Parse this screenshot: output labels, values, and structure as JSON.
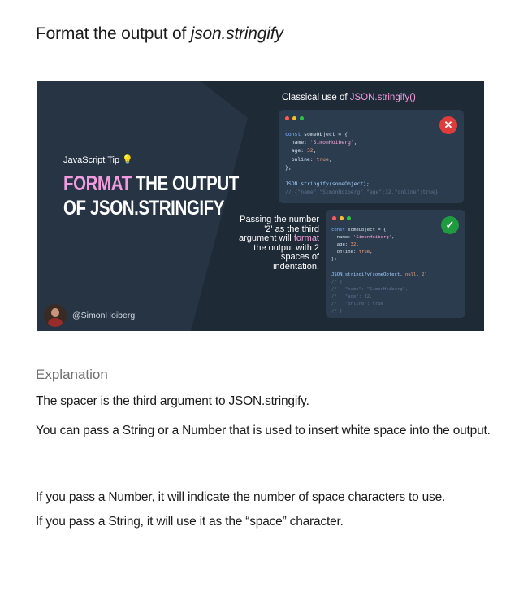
{
  "page": {
    "title_plain": "Format the output of ",
    "title_italic": "json.stringify"
  },
  "card": {
    "tip_label": "JavaScript Tip",
    "tip_icon": "lightbulb-icon",
    "headline_pink": "FORMAT",
    "headline_rest_line1": " THE OUTPUT",
    "headline_line2": "OF JSON.STRINGIFY",
    "author_handle": "@SimonHoiberg",
    "classic_title_plain": "Classical use of ",
    "classic_title_pink": "JSON.stringify()",
    "classic_code": {
      "line1_kw": "const",
      "line1_rest": " someObject = {",
      "line2_key": "  name: ",
      "line2_val": "'SimonHoiberg'",
      "line2_end": ",",
      "line3_key": "  age: ",
      "line3_val": "32",
      "line3_end": ",",
      "line4_key": "  online: ",
      "line4_val": "true",
      "line4_end": ",",
      "line5": "};",
      "line7_fn": "JSON.stringify(someObject);",
      "line8_comment": "// {\"name\":\"SimonHoiberg\",\"age\":32,\"online\":true}"
    },
    "passing_line1": "Passing the number",
    "passing_line2": "'2' as the third",
    "passing_line3_plain": "argument will ",
    "passing_line3_pink": "format",
    "passing_line4": "the output with 2",
    "passing_line5": "spaces of",
    "passing_line6": "indentation.",
    "formatted_code": {
      "line1_kw": "const",
      "line1_rest": " someObject = {",
      "line2_key": "  name: ",
      "line2_val": "'SimonHoiberg'",
      "line2_end": ",",
      "line3_key": "  age: ",
      "line3_val": "32",
      "line3_end": ",",
      "line4_key": "  online: ",
      "line4_val": "true",
      "line4_end": ",",
      "line5": "};",
      "line7_fn": "JSON.stringify(someObject, ",
      "line7_null": "null",
      "line7_mid": ", ",
      "line7_num": "2",
      "line7_end": ")",
      "c1": "// {",
      "c2": "//   \"name\": \"SimonHoiberg\",",
      "c3": "//   \"age\": 32,",
      "c4": "//   \"online\": true",
      "c5": "// }"
    },
    "status_bad_icon": "x-icon",
    "status_good_icon": "checkmark-icon"
  },
  "explanation": {
    "heading": "Explanation",
    "p1": "The spacer is the third argument to JSON.stringify.",
    "p2": "You can pass a String or a Number that is used to insert white space into the output.",
    "p3": "If you pass a Number, it will indicate the number of space characters to use.",
    "p4": "If you pass a String, it will use it as the “space” character."
  }
}
